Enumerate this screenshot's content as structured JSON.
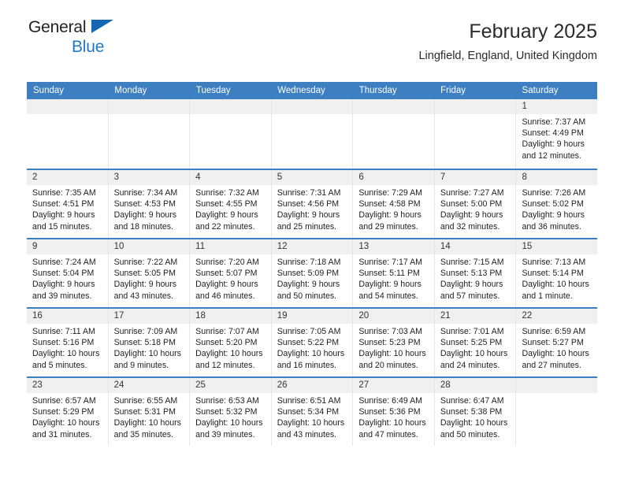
{
  "logo": {
    "line1": "General",
    "line2": "Blue",
    "triangle_color": "#1667b3",
    "blue_color": "#1f7ac4"
  },
  "header": {
    "title": "February 2025",
    "subtitle": "Lingfield, England, United Kingdom"
  },
  "theme": {
    "header_blue": "#3d7fc1",
    "daynum_band": "#f0f0f0"
  },
  "weekdays": [
    "Sunday",
    "Monday",
    "Tuesday",
    "Wednesday",
    "Thursday",
    "Friday",
    "Saturday"
  ],
  "labels": {
    "sunrise": "Sunrise:",
    "sunset": "Sunset:",
    "daylight": "Daylight:"
  },
  "weeks": [
    [
      {
        "day": "",
        "empty": true
      },
      {
        "day": "",
        "empty": true
      },
      {
        "day": "",
        "empty": true
      },
      {
        "day": "",
        "empty": true
      },
      {
        "day": "",
        "empty": true
      },
      {
        "day": "",
        "empty": true
      },
      {
        "day": "1",
        "sunrise": "Sunrise: 7:37 AM",
        "sunset": "Sunset: 4:49 PM",
        "daylight1": "Daylight: 9 hours",
        "daylight2": "and 12 minutes."
      }
    ],
    [
      {
        "day": "2",
        "sunrise": "Sunrise: 7:35 AM",
        "sunset": "Sunset: 4:51 PM",
        "daylight1": "Daylight: 9 hours",
        "daylight2": "and 15 minutes."
      },
      {
        "day": "3",
        "sunrise": "Sunrise: 7:34 AM",
        "sunset": "Sunset: 4:53 PM",
        "daylight1": "Daylight: 9 hours",
        "daylight2": "and 18 minutes."
      },
      {
        "day": "4",
        "sunrise": "Sunrise: 7:32 AM",
        "sunset": "Sunset: 4:55 PM",
        "daylight1": "Daylight: 9 hours",
        "daylight2": "and 22 minutes."
      },
      {
        "day": "5",
        "sunrise": "Sunrise: 7:31 AM",
        "sunset": "Sunset: 4:56 PM",
        "daylight1": "Daylight: 9 hours",
        "daylight2": "and 25 minutes."
      },
      {
        "day": "6",
        "sunrise": "Sunrise: 7:29 AM",
        "sunset": "Sunset: 4:58 PM",
        "daylight1": "Daylight: 9 hours",
        "daylight2": "and 29 minutes."
      },
      {
        "day": "7",
        "sunrise": "Sunrise: 7:27 AM",
        "sunset": "Sunset: 5:00 PM",
        "daylight1": "Daylight: 9 hours",
        "daylight2": "and 32 minutes."
      },
      {
        "day": "8",
        "sunrise": "Sunrise: 7:26 AM",
        "sunset": "Sunset: 5:02 PM",
        "daylight1": "Daylight: 9 hours",
        "daylight2": "and 36 minutes."
      }
    ],
    [
      {
        "day": "9",
        "sunrise": "Sunrise: 7:24 AM",
        "sunset": "Sunset: 5:04 PM",
        "daylight1": "Daylight: 9 hours",
        "daylight2": "and 39 minutes."
      },
      {
        "day": "10",
        "sunrise": "Sunrise: 7:22 AM",
        "sunset": "Sunset: 5:05 PM",
        "daylight1": "Daylight: 9 hours",
        "daylight2": "and 43 minutes."
      },
      {
        "day": "11",
        "sunrise": "Sunrise: 7:20 AM",
        "sunset": "Sunset: 5:07 PM",
        "daylight1": "Daylight: 9 hours",
        "daylight2": "and 46 minutes."
      },
      {
        "day": "12",
        "sunrise": "Sunrise: 7:18 AM",
        "sunset": "Sunset: 5:09 PM",
        "daylight1": "Daylight: 9 hours",
        "daylight2": "and 50 minutes."
      },
      {
        "day": "13",
        "sunrise": "Sunrise: 7:17 AM",
        "sunset": "Sunset: 5:11 PM",
        "daylight1": "Daylight: 9 hours",
        "daylight2": "and 54 minutes."
      },
      {
        "day": "14",
        "sunrise": "Sunrise: 7:15 AM",
        "sunset": "Sunset: 5:13 PM",
        "daylight1": "Daylight: 9 hours",
        "daylight2": "and 57 minutes."
      },
      {
        "day": "15",
        "sunrise": "Sunrise: 7:13 AM",
        "sunset": "Sunset: 5:14 PM",
        "daylight1": "Daylight: 10 hours",
        "daylight2": "and 1 minute."
      }
    ],
    [
      {
        "day": "16",
        "sunrise": "Sunrise: 7:11 AM",
        "sunset": "Sunset: 5:16 PM",
        "daylight1": "Daylight: 10 hours",
        "daylight2": "and 5 minutes."
      },
      {
        "day": "17",
        "sunrise": "Sunrise: 7:09 AM",
        "sunset": "Sunset: 5:18 PM",
        "daylight1": "Daylight: 10 hours",
        "daylight2": "and 9 minutes."
      },
      {
        "day": "18",
        "sunrise": "Sunrise: 7:07 AM",
        "sunset": "Sunset: 5:20 PM",
        "daylight1": "Daylight: 10 hours",
        "daylight2": "and 12 minutes."
      },
      {
        "day": "19",
        "sunrise": "Sunrise: 7:05 AM",
        "sunset": "Sunset: 5:22 PM",
        "daylight1": "Daylight: 10 hours",
        "daylight2": "and 16 minutes."
      },
      {
        "day": "20",
        "sunrise": "Sunrise: 7:03 AM",
        "sunset": "Sunset: 5:23 PM",
        "daylight1": "Daylight: 10 hours",
        "daylight2": "and 20 minutes."
      },
      {
        "day": "21",
        "sunrise": "Sunrise: 7:01 AM",
        "sunset": "Sunset: 5:25 PM",
        "daylight1": "Daylight: 10 hours",
        "daylight2": "and 24 minutes."
      },
      {
        "day": "22",
        "sunrise": "Sunrise: 6:59 AM",
        "sunset": "Sunset: 5:27 PM",
        "daylight1": "Daylight: 10 hours",
        "daylight2": "and 27 minutes."
      }
    ],
    [
      {
        "day": "23",
        "sunrise": "Sunrise: 6:57 AM",
        "sunset": "Sunset: 5:29 PM",
        "daylight1": "Daylight: 10 hours",
        "daylight2": "and 31 minutes."
      },
      {
        "day": "24",
        "sunrise": "Sunrise: 6:55 AM",
        "sunset": "Sunset: 5:31 PM",
        "daylight1": "Daylight: 10 hours",
        "daylight2": "and 35 minutes."
      },
      {
        "day": "25",
        "sunrise": "Sunrise: 6:53 AM",
        "sunset": "Sunset: 5:32 PM",
        "daylight1": "Daylight: 10 hours",
        "daylight2": "and 39 minutes."
      },
      {
        "day": "26",
        "sunrise": "Sunrise: 6:51 AM",
        "sunset": "Sunset: 5:34 PM",
        "daylight1": "Daylight: 10 hours",
        "daylight2": "and 43 minutes."
      },
      {
        "day": "27",
        "sunrise": "Sunrise: 6:49 AM",
        "sunset": "Sunset: 5:36 PM",
        "daylight1": "Daylight: 10 hours",
        "daylight2": "and 47 minutes."
      },
      {
        "day": "28",
        "sunrise": "Sunrise: 6:47 AM",
        "sunset": "Sunset: 5:38 PM",
        "daylight1": "Daylight: 10 hours",
        "daylight2": "and 50 minutes."
      },
      {
        "day": "",
        "empty": true
      }
    ]
  ]
}
